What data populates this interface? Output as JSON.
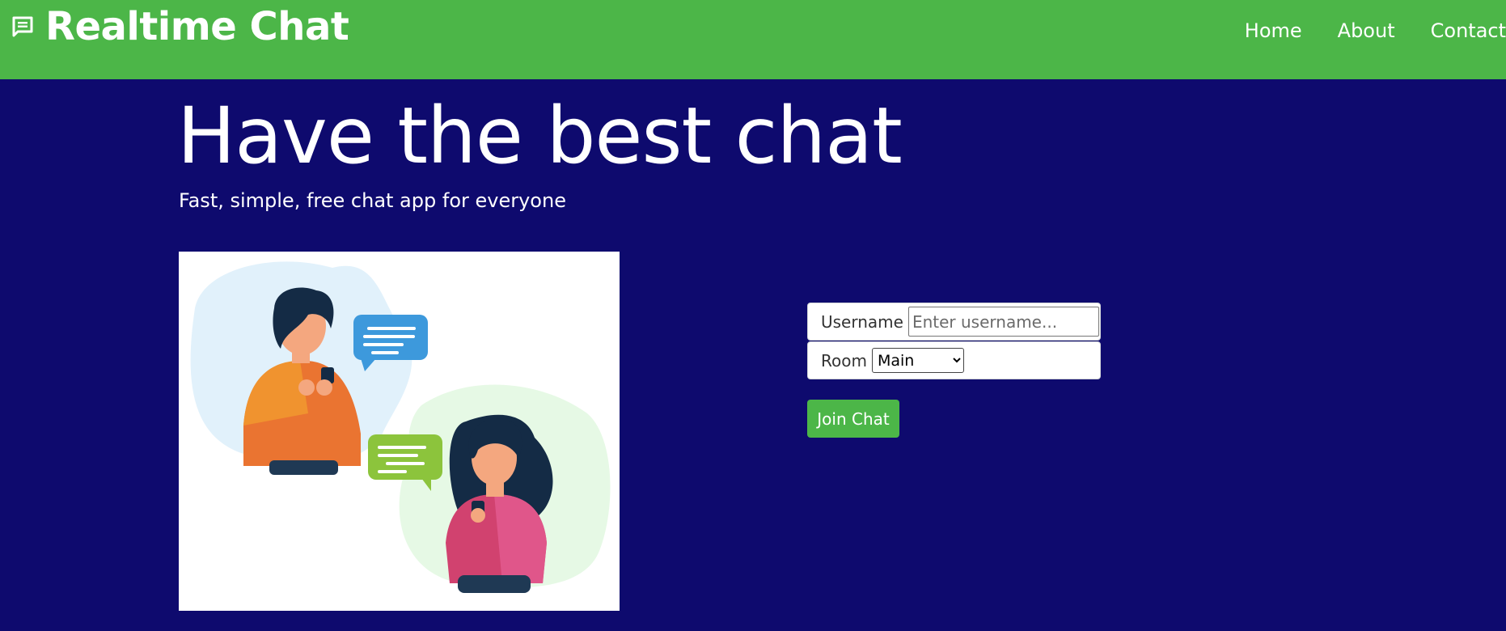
{
  "navbar": {
    "brand": "Realtime Chat",
    "brand_icon": "chat-bubble-icon",
    "links": [
      "Home",
      "About",
      "Contact"
    ]
  },
  "hero": {
    "title": "Have the best chat",
    "subtitle": "Fast, simple, free chat app for everyone"
  },
  "illustration": {
    "icon": "people-chatting-illustration"
  },
  "form": {
    "username_label": "Username",
    "username_placeholder": "Enter username...",
    "username_value": "",
    "room_label": "Room",
    "room_selected": "Main",
    "join_label": "Join Chat"
  },
  "colors": {
    "navbar": "#4cb648",
    "background": "#0e0a6e",
    "button": "#4cb648"
  }
}
